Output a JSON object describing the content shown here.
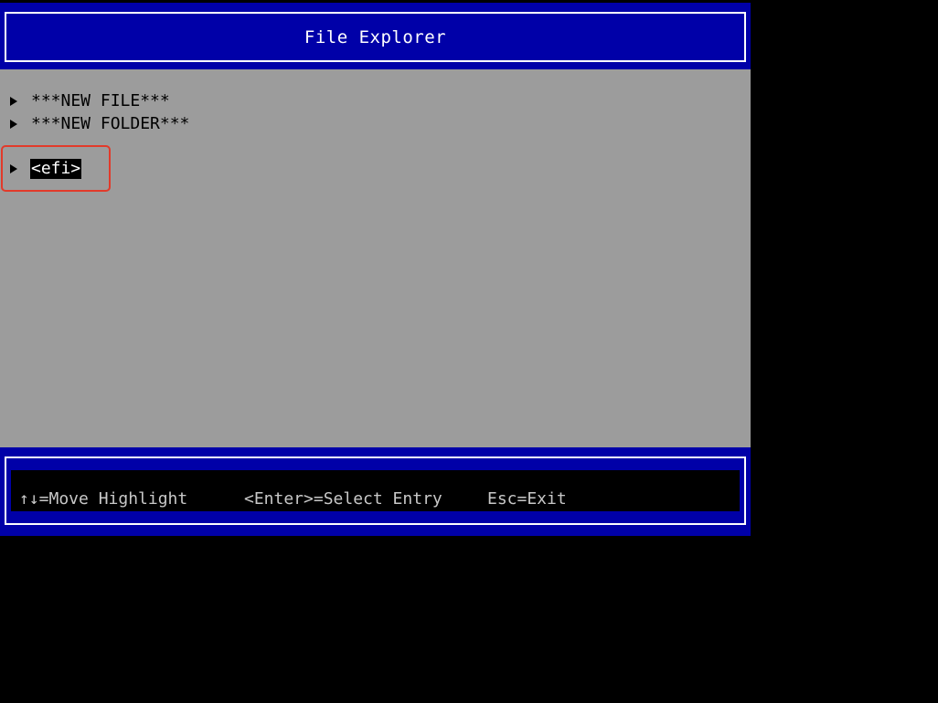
{
  "colors": {
    "header_band": "#0000a8",
    "content_background": "#9c9c9c",
    "outer_background": "#000000",
    "frame_border": "#ffffff",
    "selected_background": "#000000",
    "selected_text": "#ffffff",
    "annotation_outline": "#e23a2a"
  },
  "header": {
    "title": "File Explorer"
  },
  "entries": [
    {
      "label": "***NEW FILE***",
      "icon": "triangle-right-icon",
      "selected": false
    },
    {
      "label": "***NEW FOLDER***",
      "icon": "triangle-right-icon",
      "selected": false
    },
    {
      "label": "<efi>",
      "icon": "triangle-right-icon",
      "selected": true
    }
  ],
  "footer": {
    "hints": [
      {
        "text": "↑↓=Move Highlight"
      },
      {
        "text": "<Enter>=Select Entry"
      },
      {
        "text": "Esc=Exit"
      }
    ]
  }
}
